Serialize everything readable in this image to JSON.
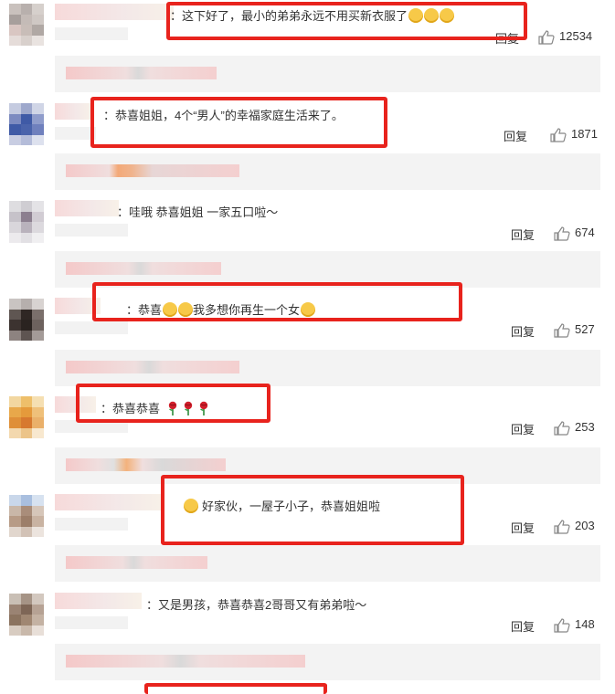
{
  "comments": [
    {
      "text": "：这下好了，最小的弟弟永远不用买新衣服了",
      "emojis": 3,
      "reply_label": "回复",
      "likes": "12534"
    },
    {
      "text": "：恭喜姐姐，4个“男人”的幸福家庭生活来了。",
      "reply_label": "回复",
      "likes": "1871"
    },
    {
      "text": "：哇哦 恭喜姐姐 一家五口啦～",
      "reply_label": "回复",
      "likes": "674"
    },
    {
      "text_a": "：恭喜",
      "text_b": "我多想你再生一个女",
      "reply_label": "回复",
      "likes": "527"
    },
    {
      "text": "：恭喜恭喜",
      "roses": 3,
      "reply_label": "回复",
      "likes": "253"
    },
    {
      "text": "好家伙，一屋子小子，恭喜姐姐啦",
      "reply_label": "回复",
      "likes": "203"
    },
    {
      "text": "：又是男孩，恭喜恭喜2哥哥又有弟弟啦～",
      "reply_label": "回复",
      "likes": "148"
    }
  ],
  "colors": {
    "highlight": "#e8231d",
    "reply_bg": "#f3f3f3",
    "emoji": "#f7c948"
  }
}
